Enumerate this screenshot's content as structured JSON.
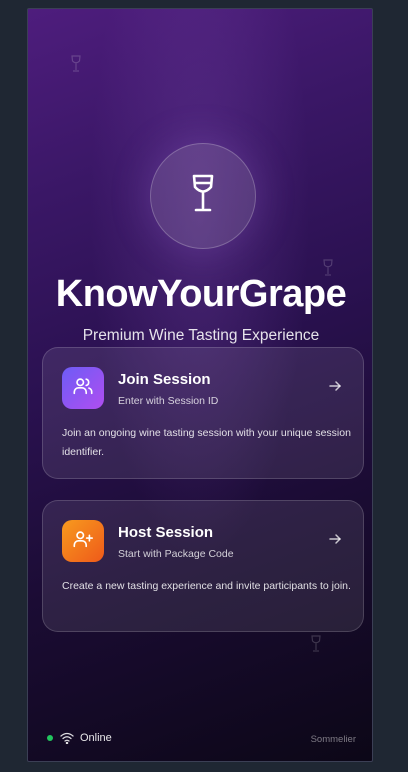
{
  "app": {
    "title": "KnowYourGrape",
    "subtitle": "Premium Wine Tasting Experience"
  },
  "cards": [
    {
      "title": "Join Session",
      "subtitle": "Enter with Session ID",
      "description": "Join an ongoing wine tasting session with your unique session identifier.",
      "icon": "users-icon",
      "color_start": "#6d5cf6",
      "color_end": "#b04ef0"
    },
    {
      "title": "Host Session",
      "subtitle": "Start with Package Code",
      "description": "Create a new tasting experience and invite participants to join.",
      "icon": "user-plus-icon",
      "color_start": "#f79a1e",
      "color_end": "#ef5a1a"
    }
  ],
  "footer": {
    "status": "Online",
    "role": "Sommelier",
    "status_color": "#22c55e"
  },
  "icons": {
    "logo": "wine-glass-icon",
    "arrow": "arrow-right-icon",
    "wifi": "wifi-icon"
  }
}
